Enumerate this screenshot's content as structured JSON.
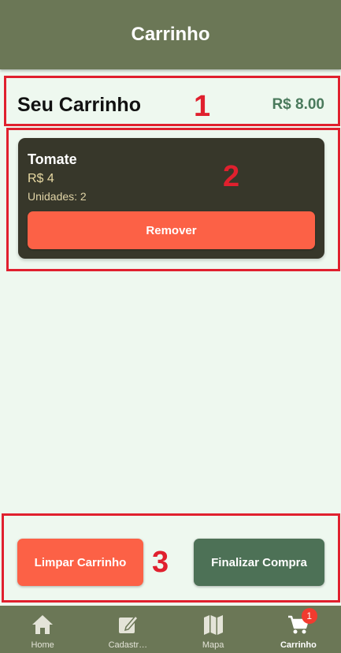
{
  "header": {
    "title": "Carrinho"
  },
  "summary": {
    "title": "Seu Carrinho",
    "total": "R$ 8.00"
  },
  "items": [
    {
      "name": "Tomate",
      "price": "R$ 4",
      "units": "Unidades: 2",
      "remove_label": "Remover"
    }
  ],
  "actions": {
    "clear_label": "Limpar Carrinho",
    "checkout_label": "Finalizar Compra"
  },
  "tabs": [
    {
      "label": "Home",
      "icon": "home-icon"
    },
    {
      "label": "Cadastr…",
      "icon": "edit-icon"
    },
    {
      "label": "Mapa",
      "icon": "map-icon"
    },
    {
      "label": "Carrinho",
      "icon": "cart-icon",
      "badge": "1",
      "active": true
    }
  ],
  "annotations": [
    "1",
    "2",
    "3"
  ],
  "colors": {
    "header": "#6b7756",
    "background": "#eef8ef",
    "card": "#37372a",
    "danger": "#fc6146",
    "confirm": "#4d7156",
    "total": "#4a7a5c",
    "annotation": "#e0202e"
  }
}
